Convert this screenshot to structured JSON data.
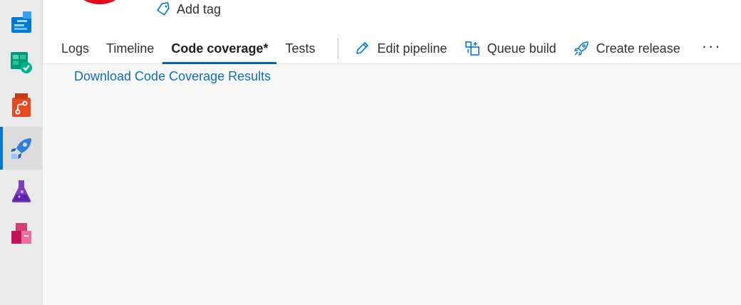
{
  "rail": {
    "items": [
      {
        "icon": "boards-icon",
        "active": false
      },
      {
        "icon": "test-plans-check-icon",
        "active": false
      },
      {
        "icon": "repos-icon",
        "active": false
      },
      {
        "icon": "pipelines-rocket-icon",
        "active": true
      },
      {
        "icon": "test-flask-icon",
        "active": false
      },
      {
        "icon": "artifacts-icon",
        "active": false
      }
    ]
  },
  "header": {
    "add_tag_label": "Add tag"
  },
  "tabs": [
    {
      "label": "Logs",
      "selected": false
    },
    {
      "label": "Timeline",
      "selected": false
    },
    {
      "label": "Code coverage*",
      "selected": true
    },
    {
      "label": "Tests",
      "selected": false
    }
  ],
  "commands": {
    "edit_pipeline": "Edit pipeline",
    "queue_build": "Queue build",
    "create_release": "Create release",
    "more": "···"
  },
  "content": {
    "download_link": "Download Code Coverage Results"
  },
  "colors": {
    "accent": "#0078d4",
    "link": "#106ebe",
    "avatar": "#e00b1c"
  }
}
